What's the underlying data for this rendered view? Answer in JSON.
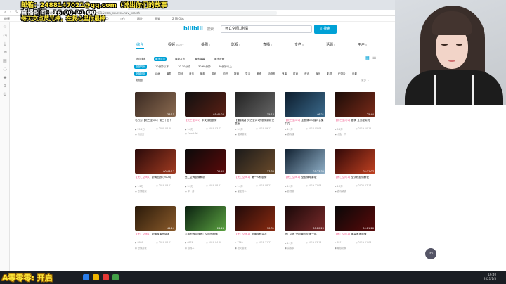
{
  "browser": {
    "tabs": [
      {
        "label": "【死亡空间1】剧情 | 神秘大事件 - 哔哩哔...",
        "active": false
      },
      {
        "label": "死亡空间 - 哔哩哔哩",
        "active": true
      },
      {
        "label": "死亡空间1 单机大游戏(完美...",
        "active": false
      }
    ],
    "url": "https://search.bilibili.com/all?keyword=死亡空间1&from_source=nav_search",
    "bookmarks": [
      "极速",
      "主页",
      "必应",
      "百度一下",
      "1(1)-知乎",
      "2(MAC)",
      "工作",
      "网址",
      "天猫",
      "2 MICRA"
    ]
  },
  "search": {
    "logo": "bilibili",
    "logo_suffix": "| 搜索",
    "query": "死亡空间1剧情",
    "button_label": "搜索"
  },
  "nav_tabs": [
    {
      "label": "综合",
      "count": "",
      "active": true
    },
    {
      "label": "视频",
      "count": "1000+",
      "active": false
    },
    {
      "label": "番剧",
      "count": "0",
      "active": false
    },
    {
      "label": "影视",
      "count": "0",
      "active": false
    },
    {
      "label": "直播",
      "count": "0",
      "active": false
    },
    {
      "label": "专栏",
      "count": "0",
      "active": false
    },
    {
      "label": "话题",
      "count": "0",
      "active": false
    },
    {
      "label": "用户",
      "count": "0",
      "active": false
    }
  ],
  "sort_options": [
    "综合排序",
    "最多点击",
    "最新发布",
    "最多弹幕",
    "最多收藏"
  ],
  "duration_options": [
    "全部时长",
    "10分钟以下",
    "10-30分钟",
    "30-60分钟",
    "60分钟以上"
  ],
  "zone_options": [
    "全部分区",
    "动画",
    "番剧",
    "国创",
    "音乐",
    "舞蹈",
    "游戏",
    "知识",
    "数码",
    "生活",
    "美食",
    "动物圈",
    "鬼畜",
    "时尚",
    "资讯",
    "娱乐",
    "影视",
    "纪录片",
    "电影",
    "电视剧"
  ],
  "more_label": "更多",
  "videos": [
    {
      "title_hl": "",
      "title": "马万对【死亡空间1】第二十五个",
      "duration": "38:11",
      "plays": "25.1万",
      "date": "2020-06-28",
      "author": "马万万"
    },
    {
      "title_hl": "【死亡空间1】",
      "title": "中文流程剧情",
      "duration": "01:41:26",
      "plays": "9.8万",
      "date": "2019-03-02",
      "author": "Smart 96"
    },
    {
      "title_hl": "",
      "title": "【重制版】死亡空间1的剧情解析完整版",
      "duration": "15:16",
      "plays": "3.5万",
      "date": "2019-09-12",
      "author": "图解游戏"
    },
    {
      "title_hl": "【死亡空间1】",
      "title": "全剧情CG 播片合集中文",
      "duration": "46:21",
      "plays": "2.1万",
      "date": "2018-05-03",
      "author": "游戏通"
    },
    {
      "title_hl": "【死亡空间1】",
      "title": "剧情 全流程实况",
      "duration": "25:44",
      "plays": "5.4万",
      "date": "2019-10-15",
      "author": "小鱼一只"
    },
    {
      "title_hl": "【死亡空间1】",
      "title": "剧情回顾 (2008)",
      "duration": "00:48:17",
      "plays": "1.2万",
      "date": "2019-03-11",
      "author": "恐惧档案"
    },
    {
      "title_hl": "",
      "title": "死亡空间剧情解析",
      "duration": "22:44",
      "plays": "3.3万",
      "date": "2019-08-21",
      "author": "伊一游"
    },
    {
      "title_hl": "【死亡空间1】",
      "title": "第一人称剧情",
      "duration": "17:36",
      "plays": "1.6万",
      "date": "2019-08-23",
      "author": "星空的人"
    },
    {
      "title_hl": "【死亡空间1】",
      "title": "全剧情电影版",
      "duration": "01:23:30",
      "plays": "1.5万",
      "date": "2019-12-08",
      "author": "影视游"
    },
    {
      "title_hl": "【死亡空间1】",
      "title": "全流程剧情解说",
      "duration": "05:11:07",
      "plays": "1.9万",
      "date": "2020-07-17",
      "author": "游戏解说"
    },
    {
      "title_hl": "【死亡空间1】",
      "title": "剧情故事完整版",
      "duration": "44:14",
      "plays": "8959",
      "date": "2019-06-13",
      "author": "恐怖游戏"
    },
    {
      "title_hl": "",
      "title": "宇宙恐怖游戏死亡空间的剧情",
      "duration": "24:24",
      "plays": "6974",
      "date": "2019-04-28",
      "author": "游戏人"
    },
    {
      "title_hl": "【死亡空间1】",
      "title": "剧情流程实况",
      "duration": "10:31",
      "plays": "7749",
      "date": "2018-11-22",
      "author": "枪火游戏"
    },
    {
      "title_hl": "",
      "title": "死亡空间 全剧情回顾 第一部",
      "duration": "00:20:20",
      "plays": "1.1万",
      "date": "2019-03-18",
      "author": "讲故事"
    },
    {
      "title_hl": "【死亡空间1】",
      "title": "最高难度剧情",
      "duration": "00:21:26",
      "plays": "9211",
      "date": "2019-01-08",
      "author": "硬核玩家"
    }
  ],
  "overlay": {
    "line1": "邮箱：2488147021@qq.com（说出你们的故事",
    "line2": "直播时间：16:00-21:00",
    "line3": "每天交点荧光棒，在我心里你最棒",
    "banner": "A零零零:  开启"
  },
  "taskbar": {
    "time": "16:40",
    "date": "2021/1/8"
  },
  "bubble": "1tb",
  "colors": {
    "accent": "#00a1d6",
    "highlight": "#f25d8e"
  }
}
